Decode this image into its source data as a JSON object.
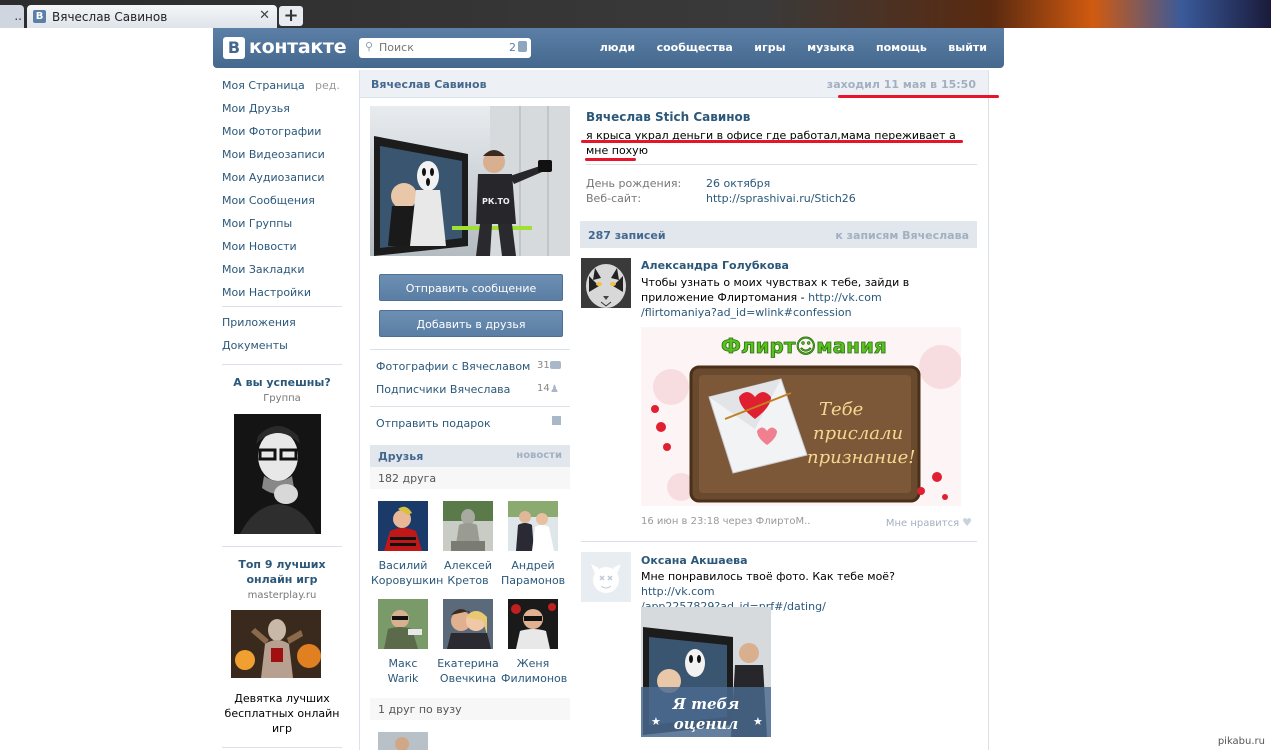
{
  "browser": {
    "tab_stub": "..",
    "tab_title": "Вячеслав Савинов",
    "tab_favicon": "В",
    "close_glyph": "✕",
    "newtab_glyph": "+"
  },
  "header": {
    "logo_letter": "В",
    "logo_text": "контакте",
    "search_placeholder": "Поиск",
    "search_count": "2",
    "nav": [
      "люди",
      "сообщества",
      "игры",
      "музыка",
      "помощь",
      "выйти"
    ]
  },
  "menu": {
    "items": [
      "Моя Страница",
      "Мои Друзья",
      "Мои Фотографии",
      "Мои Видеозаписи",
      "Мои Аудиозаписи",
      "Мои Сообщения",
      "Мои Группы",
      "Мои Новости",
      "Мои Закладки",
      "Мои Настройки"
    ],
    "edit": "ред.",
    "extra": [
      "Приложения",
      "Документы"
    ]
  },
  "ads": [
    {
      "title": "А вы успешны?",
      "sub": "Группа"
    },
    {
      "title": "Топ 9 лучших онлайн игр",
      "sub": "masterplay.ru",
      "desc": "Девятка лучших бесплатных онлайн игр"
    }
  ],
  "profile": {
    "head_name": "Вячеслав Савинов",
    "last_seen": "заходил 11 мая в 15:50",
    "full_name": "Вячеслав Stich Савинов",
    "status": "я крыса украл деньги в офисе где работал,мама переживает а мне похую",
    "info": [
      {
        "label": "День рождения:",
        "value": "26 октября"
      },
      {
        "label": "Веб-сайт:",
        "value": "http://sprashivai.ru/Stich26"
      }
    ],
    "send_message": "Отправить сообщение",
    "add_friend": "Добавить в друзья",
    "photos_with": "Фотографии с Вячеславом",
    "photos_count": "31",
    "followers": "Подписчики Вячеслава",
    "followers_count": "14",
    "send_gift": "Отправить подарок"
  },
  "friends": {
    "title": "Друзья",
    "news": "новости",
    "count": "182 друга",
    "list": [
      {
        "first": "Василий",
        "last": "Коровушкин"
      },
      {
        "first": "Алексей",
        "last": "Кретов"
      },
      {
        "first": "Андрей",
        "last": "Парамонов"
      },
      {
        "first": "Макс",
        "last": "Warik"
      },
      {
        "first": "Екатерина",
        "last": "Овечкина"
      },
      {
        "first": "Женя",
        "last": "Филимонов"
      }
    ],
    "uni": "1 друг по вузу"
  },
  "wall": {
    "count": "287 записей",
    "to_wall": "к записям Вячеслава",
    "posts": [
      {
        "author": "Александра Голубкова",
        "text": "Чтобы узнать о моих чувствах к тебе, зайди в приложение Флиртомания - ",
        "link1": "http://vk.com",
        "link2": "/flirtomaniya?ad_id=wlink#confession",
        "banner_logo": "Флирт☺мания",
        "banner_text1": "Тебе",
        "banner_text2": "прислали",
        "banner_text3": "признание!",
        "meta": "16 июн в 23:18 через ФлиртоМ..",
        "like": "Мне нравится"
      },
      {
        "author": "Оксана Акшаева",
        "text": "Мне понравилось твоё фото. Как тебе моё? ",
        "link1": "http://vk.com",
        "link2": "/app2257829?ad_id=prf#/dating/",
        "overlay1": "Я тебя",
        "overlay2": "оценил"
      }
    ]
  },
  "watermark": "pikabu.ru",
  "colors": {
    "accent": "#45688e",
    "link": "#2b587a",
    "highlight": "#e8152a"
  }
}
